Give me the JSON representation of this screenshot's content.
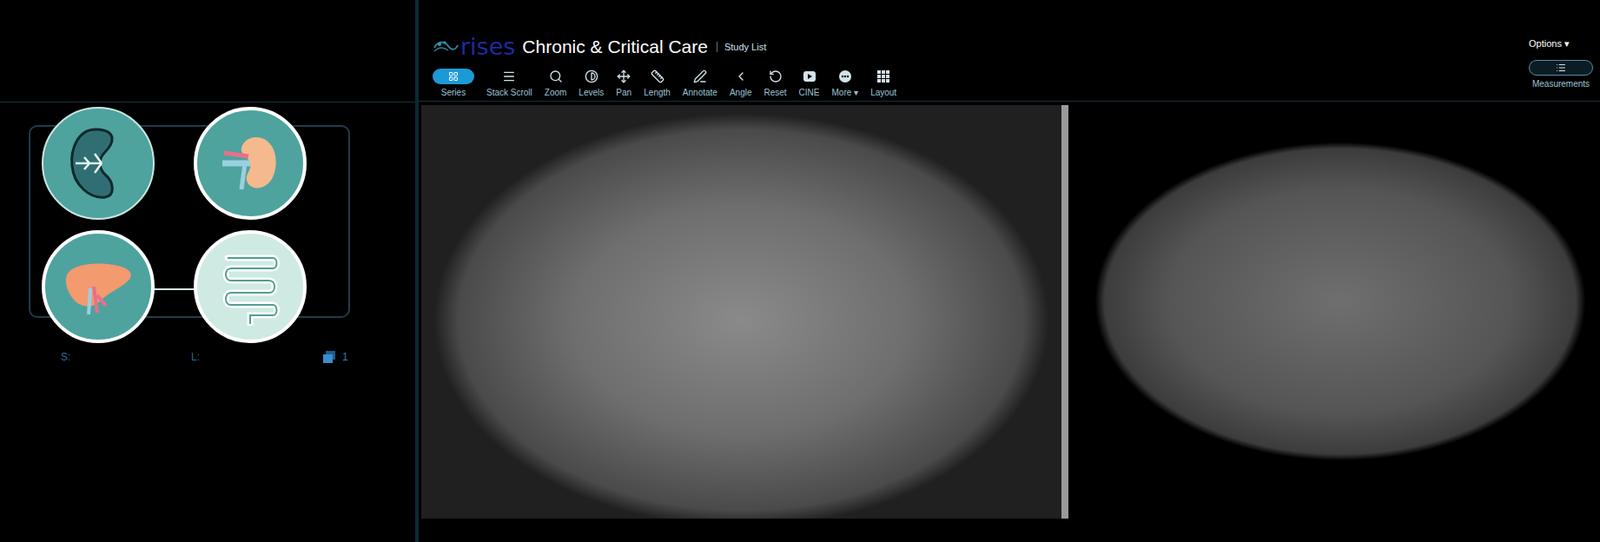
{
  "header": {
    "logo": "rises",
    "title": "Chronic & Critical Care",
    "study_list": "Study List"
  },
  "toolbar": [
    {
      "label": "Series",
      "selected": true
    },
    {
      "label": "Stack Scroll",
      "selected": false
    },
    {
      "label": "Zoom",
      "selected": false
    },
    {
      "label": "Levels",
      "selected": false
    },
    {
      "label": "Pan",
      "selected": false
    },
    {
      "label": "Length",
      "selected": false
    },
    {
      "label": "Annotate",
      "selected": false
    },
    {
      "label": "Angle",
      "selected": false
    },
    {
      "label": "Reset",
      "selected": false
    },
    {
      "label": "CINE",
      "selected": false
    },
    {
      "label": "More",
      "selected": false,
      "caret": "▾"
    },
    {
      "label": "Layout",
      "selected": false
    }
  ],
  "options": {
    "label": "Options",
    "caret": "▾"
  },
  "measurements": {
    "label": "Measurements"
  },
  "sidebar": {
    "labels": [
      "S:",
      "L:"
    ],
    "count": "1"
  }
}
